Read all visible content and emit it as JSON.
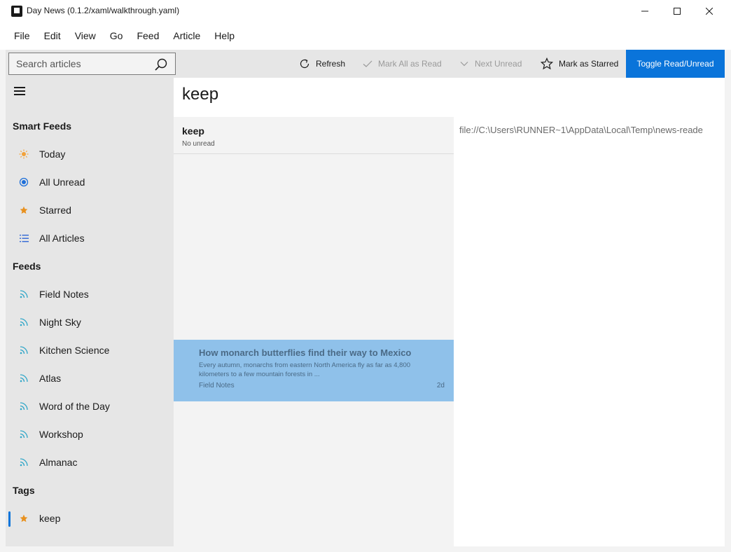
{
  "window": {
    "title": "Day News (0.1.2/xaml/walkthrough.yaml)"
  },
  "menu": [
    "File",
    "Edit",
    "View",
    "Go",
    "Feed",
    "Article",
    "Help"
  ],
  "toolbar": {
    "search_placeholder": "Search articles",
    "refresh": "Refresh",
    "mark_all_read": "Mark All as Read",
    "next_unread": "Next Unread",
    "mark_starred": "Mark as Starred",
    "toggle_read": "Toggle Read/Unread",
    "accent_color": "#0a74da"
  },
  "sidebar": {
    "smart_heading": "Smart Feeds",
    "smart": [
      {
        "label": "Today",
        "icon": "sun-icon"
      },
      {
        "label": "All Unread",
        "icon": "radio-icon"
      },
      {
        "label": "Starred",
        "icon": "star-icon"
      },
      {
        "label": "All Articles",
        "icon": "list-icon"
      }
    ],
    "feeds_heading": "Feeds",
    "feeds": [
      {
        "label": "Field Notes",
        "icon": "rss-icon"
      },
      {
        "label": "Night Sky",
        "icon": "rss-icon"
      },
      {
        "label": "Kitchen Science",
        "icon": "rss-icon"
      },
      {
        "label": "Atlas",
        "icon": "rss-icon"
      },
      {
        "label": "Word of the Day",
        "icon": "rss-icon"
      },
      {
        "label": "Workshop",
        "icon": "rss-icon"
      },
      {
        "label": "Almanac",
        "icon": "rss-icon"
      }
    ],
    "tags_heading": "Tags",
    "tags": [
      {
        "label": "keep",
        "icon": "star-icon",
        "selected": true
      }
    ]
  },
  "main": {
    "title": "keep",
    "feed": {
      "name": "keep",
      "unread": "No unread"
    },
    "articles": [
      {
        "title": "How monarch butterflies find their way to Mexico",
        "snippet": "Every autumn, monarchs from eastern North America fly as far as 4,800 kilometers to a few mountain forests in ...",
        "feed": "Field Notes",
        "age": "2d",
        "selected": true
      }
    ],
    "reader_url": "file://C:\\Users\\RUNNER~1\\AppData\\Local\\Temp\\news-reade"
  }
}
